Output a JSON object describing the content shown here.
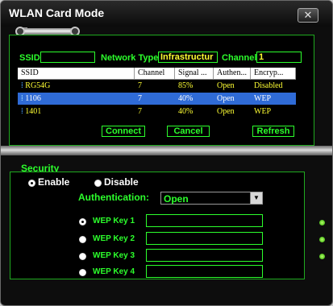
{
  "window": {
    "title": "WLAN Card Mode",
    "close_glyph": "✕"
  },
  "filter": {
    "ssid_label": "SSID",
    "ssid_value": "",
    "network_type_label": "Network Type",
    "network_type_value": "Infrastructur",
    "channel_label": "Channel",
    "channel_value": "1"
  },
  "table": {
    "columns": [
      "SSID",
      "Channel",
      "Signal ...",
      "Authen...",
      "Encryp..."
    ],
    "rows": [
      {
        "ssid": "RG54G",
        "channel": "7",
        "signal": "85%",
        "auth": "Open",
        "encryption": "Disabled",
        "selected": false
      },
      {
        "ssid": "1106",
        "channel": "7",
        "signal": "40%",
        "auth": "Open",
        "encryption": "WEP",
        "selected": true
      },
      {
        "ssid": "1401",
        "channel": "7",
        "signal": "40%",
        "auth": "Open",
        "encryption": "WEP",
        "selected": false
      }
    ]
  },
  "buttons": {
    "connect": "Connect",
    "cancel": "Cancel",
    "refresh": "Refresh"
  },
  "security": {
    "label": "Security",
    "enable_label": "Enable",
    "disable_label": "Disable",
    "selected": "Enable",
    "auth_label": "Authentication:",
    "auth_value": "Open",
    "wep_keys": [
      {
        "label": "WEP Key 1",
        "value": ""
      },
      {
        "label": "WEP Key 2",
        "value": ""
      },
      {
        "label": "WEP Key 3",
        "value": ""
      },
      {
        "label": "WEP Key 4",
        "value": ""
      }
    ],
    "selected_key": "WEP Key 1"
  },
  "colors": {
    "accent": "#2cff2c",
    "value_text": "#ffff33",
    "selection": "#2f6bd6",
    "background": "#000000"
  }
}
